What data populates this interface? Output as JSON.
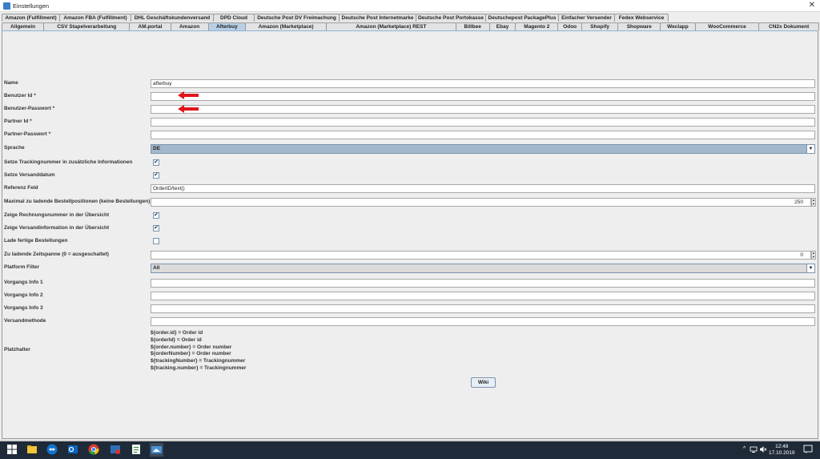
{
  "window": {
    "title": "Einstellungen",
    "close_glyph": "✕"
  },
  "tabs_row1": [
    "Amazon (Fulfillment)",
    "Amazon FBA (Fulfillment)",
    "DHL Geschäftskundenversand",
    "DPD Cloud",
    "Deutsche Post DV Freimachung",
    "Deutsche Post Internetmarke",
    "Deutsche Post Portokasse",
    "Deutschepost PackagePlus",
    "Einfacher Versender",
    "Fedex Webservice"
  ],
  "tabs_row2": [
    "Allgemein",
    "CSV Stapelverarbeitung",
    "AM.portal",
    "Amazon",
    "Afterbuy",
    "Amazon (Marketplace)",
    "Amazon (Marketplace) REST",
    "Billbee",
    "Ebay",
    "Magento 2",
    "Odoo",
    "Shopify",
    "Shopware",
    "Weclapp",
    "WooCommerce",
    "CN2x Dokument"
  ],
  "active_tab": "Afterbuy",
  "form": {
    "name": {
      "label": "Name",
      "value": "afterbuy"
    },
    "benutzer_id": {
      "label": "Benutzer Id *",
      "value": ""
    },
    "benutzer_passwort": {
      "label": "Benutzer-Passwort *",
      "value": ""
    },
    "partner_id": {
      "label": "Partner Id *",
      "value": ""
    },
    "partner_passwort": {
      "label": "Partner-Passwort *",
      "value": ""
    },
    "sprache": {
      "label": "Sprache",
      "value": "DE"
    },
    "setze_tracking": {
      "label": "Setze Trackingnummer in zusätzliche Informationen",
      "checked": true
    },
    "setze_versanddatum": {
      "label": "Setze Versanddatum",
      "checked": true
    },
    "referenz_feld": {
      "label": "Referenz Feld",
      "value": "OrderID/text()"
    },
    "max_positionen": {
      "label": "Maximal zu ladende Bestellpositionen (keine Bestellungen)",
      "value": "250"
    },
    "zeige_rechnungsnummer": {
      "label": "Zeige Rechnungsnummer in der Übersicht",
      "checked": true
    },
    "zeige_versandinfo": {
      "label": "Zeige Versandinformation in der Übersicht",
      "checked": true
    },
    "lade_fertige": {
      "label": "Lade fertige Bestellungen",
      "checked": false
    },
    "zeitspanne": {
      "label": "Zu ladende Zeitspanne (0 = ausgeschaltet)",
      "value": "0"
    },
    "platform_filter": {
      "label": "Platform Filter",
      "value": "All"
    },
    "vorgangs_info_1": {
      "label": "Vorgangs Info 1",
      "value": ""
    },
    "vorgangs_info_2": {
      "label": "Vorgangs Info 2",
      "value": ""
    },
    "vorgangs_info_3": {
      "label": "Vorgangs Info 3",
      "value": ""
    },
    "versandmethode": {
      "label": "Versandmethode",
      "value": ""
    }
  },
  "platzhalter": {
    "label": "Platzhalter",
    "lines": [
      "${order.id} = Order id",
      "${orderId} = Order id",
      "${order.number} = Order number",
      "${orderNumber} = Order number",
      "${trackingNumber} = Trackingnummer",
      "${tracking.number} =  Trackingnummer"
    ]
  },
  "wiki_button": "Wiki",
  "check_glyph": "✔",
  "dropdown_glyph": "▼",
  "spinner": {
    "up": "▲",
    "down": "▼"
  },
  "taskbar": {
    "time": "12:48",
    "date": "17.10.2019",
    "tray_icons": [
      "chevron-up-icon",
      "network-icon",
      "speaker-muted-icon",
      "notification-icon"
    ],
    "apps": [
      "windows-start-icon",
      "file-explorer-icon",
      "teamviewer-icon",
      "outlook-icon",
      "chrome-icon",
      "mail-app-icon",
      "notepad-app-icon",
      "java-app-icon"
    ]
  },
  "colors": {
    "active_tab": "#b8cfe5",
    "select_highlight": "#a3b8cc",
    "arrow": "#e0161c",
    "taskbar": "#1f2a38"
  }
}
